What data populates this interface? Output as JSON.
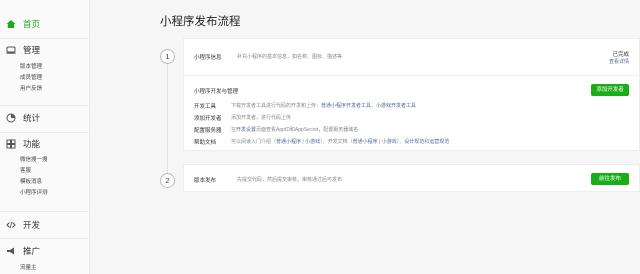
{
  "sidebar": {
    "home": "首页",
    "manage": {
      "label": "管理",
      "items": [
        "版本管理",
        "成员管理",
        "用户反馈"
      ]
    },
    "stats": "统计",
    "features": {
      "label": "功能",
      "items": [
        "微信搜一搜",
        "客服",
        "模板消息",
        "小程序评测"
      ]
    },
    "develop": "开发",
    "promote": {
      "label": "推广",
      "items": [
        "流量主"
      ]
    }
  },
  "page": {
    "title": "小程序发布流程"
  },
  "step1": {
    "number": "1",
    "info_label": "小程序信息",
    "info_desc": "补充小程序的基本信息，如名称、图标、描述等",
    "status": "已完成",
    "status_link": "查看详情",
    "dev_title": "小程序开发与管理",
    "add_dev_button": "添加开发者",
    "rows": [
      {
        "label": "开发工具",
        "desc": "下载开发者工具进行代码的开发和上传：",
        "link1": "普通小程序开发者工具",
        "sep": "、",
        "link2": "小游戏开发者工具"
      },
      {
        "label": "添加开发者",
        "desc": "添加开发者，进行代码上传"
      },
      {
        "label": "配置服务器",
        "desc_pre": "在",
        "link1": "开发设置",
        "desc_post": "页面查看AppID和AppSecret，配置服务器域名"
      },
      {
        "label": "帮助文档",
        "desc": "可以阅读入门介绍（",
        "link1": "普通小程序",
        "sep1": " | ",
        "link2": "小游戏",
        "mid": "）、开发文档（",
        "link3": "普通小程序",
        "sep2": " | ",
        "link4": "小游戏",
        "end": "）、",
        "link5": "设计规范",
        "sep3": "和",
        "link6": "运营规范"
      }
    ]
  },
  "step2": {
    "number": "2",
    "label": "版本发布",
    "desc": "先提交代码，然后提交审核，审核通过后可发布",
    "button": "前往发布"
  },
  "colors": {
    "accent": "#1aad19",
    "link": "#576b95"
  }
}
